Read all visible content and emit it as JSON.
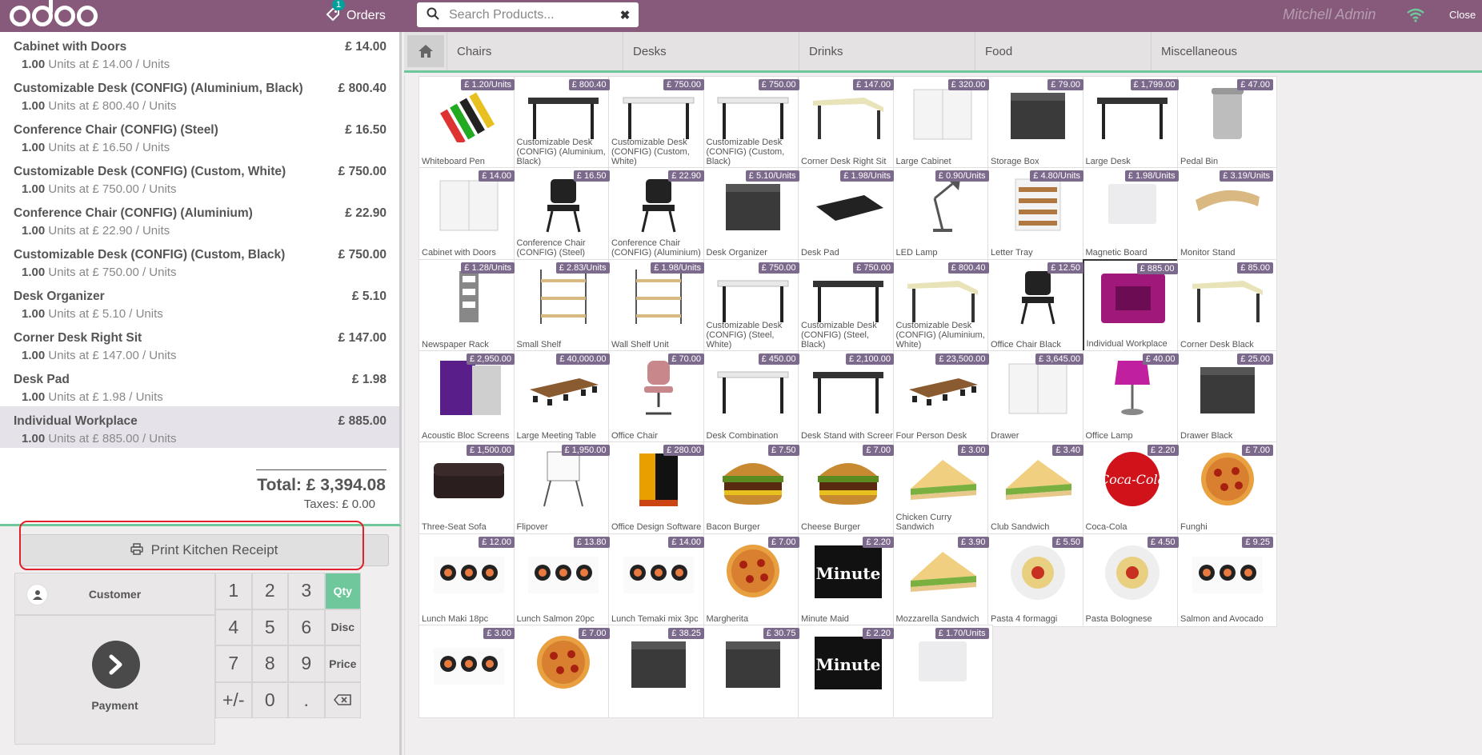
{
  "topbar": {
    "orders_label": "Orders",
    "orders_count": "1",
    "search_placeholder": "Search Products...",
    "user_name": "Mitchell Admin",
    "close_label": "Close"
  },
  "order": {
    "lines": [
      {
        "name": "Cabinet with Doors",
        "qty": "1.00",
        "info": "Units at £ 14.00 / Units",
        "price": "£ 14.00"
      },
      {
        "name": "Customizable Desk (CONFIG) (Aluminium, Black)",
        "qty": "1.00",
        "info": "Units at £ 800.40 / Units",
        "price": "£ 800.40"
      },
      {
        "name": "Conference Chair (CONFIG) (Steel)",
        "qty": "1.00",
        "info": "Units at £ 16.50 / Units",
        "price": "£ 16.50"
      },
      {
        "name": "Customizable Desk (CONFIG) (Custom, White)",
        "qty": "1.00",
        "info": "Units at £ 750.00 / Units",
        "price": "£ 750.00"
      },
      {
        "name": "Conference Chair (CONFIG) (Aluminium)",
        "qty": "1.00",
        "info": "Units at £ 22.90 / Units",
        "price": "£ 22.90"
      },
      {
        "name": "Customizable Desk (CONFIG) (Custom, Black)",
        "qty": "1.00",
        "info": "Units at £ 750.00 / Units",
        "price": "£ 750.00"
      },
      {
        "name": "Desk Organizer",
        "qty": "1.00",
        "info": "Units at £ 5.10 / Units",
        "price": "£ 5.10"
      },
      {
        "name": "Corner Desk Right Sit",
        "qty": "1.00",
        "info": "Units at £ 147.00 / Units",
        "price": "£ 147.00"
      },
      {
        "name": "Desk Pad",
        "qty": "1.00",
        "info": "Units at £ 1.98 / Units",
        "price": "£ 1.98"
      },
      {
        "name": "Individual Workplace",
        "qty": "1.00",
        "info": "Units at £ 885.00 / Units",
        "price": "£ 885.00"
      }
    ],
    "total": "Total: £ 3,394.08",
    "taxes": "Taxes: £ 0.00"
  },
  "controls": {
    "kitchen_label": "Print Kitchen Receipt",
    "customer_label": "Customer",
    "payment_label": "Payment",
    "keys": [
      "1",
      "2",
      "3",
      "4",
      "5",
      "6",
      "7",
      "8",
      "9",
      "+/-",
      "0",
      "."
    ],
    "modes": [
      "Qty",
      "Disc",
      "Price"
    ]
  },
  "categories": [
    "Chairs",
    "Desks",
    "Drinks",
    "Food",
    "Miscellaneous"
  ],
  "colors": {
    "brand": "#875a7b",
    "accent": "#6ec89b",
    "badge": "#7c6a8c",
    "highlight": "#e0202a"
  },
  "products": [
    {
      "name": "Whiteboard Pen",
      "price": "£ 1.20/Units",
      "icon": "pens"
    },
    {
      "name": "Customizable Desk (CONFIG) (Aluminium, Black)",
      "price": "£ 800.40",
      "icon": "desk-dark"
    },
    {
      "name": "Customizable Desk (CONFIG) (Custom, White)",
      "price": "£ 750.00",
      "icon": "desk-white"
    },
    {
      "name": "Customizable Desk (CONFIG) (Custom, Black)",
      "price": "£ 750.00",
      "icon": "desk-white"
    },
    {
      "name": "Corner Desk Right Sit",
      "price": "£ 147.00",
      "icon": "desk-cream"
    },
    {
      "name": "Large Cabinet",
      "price": "£ 320.00",
      "icon": "cabinet-white"
    },
    {
      "name": "Storage Box",
      "price": "£ 79.00",
      "icon": "box-dark"
    },
    {
      "name": "Large Desk",
      "price": "£ 1,799.00",
      "icon": "desk-dark"
    },
    {
      "name": "Pedal Bin",
      "price": "£ 47.00",
      "icon": "bin"
    },
    {
      "name": "Cabinet with Doors",
      "price": "£ 14.00",
      "icon": "cabinet-white"
    },
    {
      "name": "Conference Chair (CONFIG) (Steel)",
      "price": "£ 16.50",
      "icon": "chair-dark"
    },
    {
      "name": "Conference Chair (CONFIG) (Aluminium)",
      "price": "£ 22.90",
      "icon": "chair-dark"
    },
    {
      "name": "Desk Organizer",
      "price": "£ 5.10/Units",
      "icon": "box-dark"
    },
    {
      "name": "Desk Pad",
      "price": "£ 1.98/Units",
      "icon": "pad"
    },
    {
      "name": "LED Lamp",
      "price": "£ 0.90/Units",
      "icon": "lamp"
    },
    {
      "name": "Letter Tray",
      "price": "£ 4.80/Units",
      "icon": "tray"
    },
    {
      "name": "Magnetic Board",
      "price": "£ 1.98/Units",
      "icon": "board"
    },
    {
      "name": "Monitor Stand",
      "price": "£ 3.19/Units",
      "icon": "stand"
    },
    {
      "name": "Newspaper Rack",
      "price": "£ 1.28/Units",
      "icon": "rack"
    },
    {
      "name": "Small Shelf",
      "price": "£ 2.83/Units",
      "icon": "shelf"
    },
    {
      "name": "Wall Shelf Unit",
      "price": "£ 1.98/Units",
      "icon": "shelf"
    },
    {
      "name": "Customizable Desk (CONFIG) (Steel, White)",
      "price": "£ 750.00",
      "icon": "desk-white"
    },
    {
      "name": "Customizable Desk (CONFIG) (Steel, Black)",
      "price": "£ 750.00",
      "icon": "desk-dark"
    },
    {
      "name": "Customizable Desk (CONFIG) (Aluminium, White)",
      "price": "£ 800.40",
      "icon": "desk-cream"
    },
    {
      "name": "Office Chair Black",
      "price": "£ 12.50",
      "icon": "chair-dark"
    },
    {
      "name": "Individual Workplace",
      "price": "£ 885.00",
      "icon": "pod",
      "selected": true
    },
    {
      "name": "Corner Desk Black",
      "price": "£ 85.00",
      "icon": "desk-cream"
    },
    {
      "name": "Acoustic Bloc Screens",
      "price": "£ 2,950.00",
      "icon": "screen"
    },
    {
      "name": "Large Meeting Table",
      "price": "£ 40,000.00",
      "icon": "table"
    },
    {
      "name": "Office Chair",
      "price": "£ 70.00",
      "icon": "chair-pink"
    },
    {
      "name": "Desk Combination",
      "price": "£ 450.00",
      "icon": "desk-white"
    },
    {
      "name": "Desk Stand with Screen",
      "price": "£ 2,100.00",
      "icon": "desk-dark"
    },
    {
      "name": "Four Person Desk",
      "price": "£ 23,500.00",
      "icon": "table"
    },
    {
      "name": "Drawer",
      "price": "£ 3,645.00",
      "icon": "cabinet-white"
    },
    {
      "name": "Office Lamp",
      "price": "£ 40.00",
      "icon": "lamp-pink"
    },
    {
      "name": "Drawer Black",
      "price": "£ 25.00",
      "icon": "box-dark"
    },
    {
      "name": "Three-Seat Sofa",
      "price": "£ 1,500.00",
      "icon": "sofa"
    },
    {
      "name": "Flipover",
      "price": "£ 1,950.00",
      "icon": "flip"
    },
    {
      "name": "Office Design Software",
      "price": "£ 280.00",
      "icon": "software"
    },
    {
      "name": "Bacon Burger",
      "price": "£ 7.50",
      "icon": "burger"
    },
    {
      "name": "Cheese Burger",
      "price": "£ 7.00",
      "icon": "burger"
    },
    {
      "name": "Chicken Curry Sandwich",
      "price": "£ 3.00",
      "icon": "sandwich"
    },
    {
      "name": "Club Sandwich",
      "price": "£ 3.40",
      "icon": "sandwich"
    },
    {
      "name": "Coca-Cola",
      "price": "£ 2.20",
      "icon": "cola"
    },
    {
      "name": "Funghi",
      "price": "£ 7.00",
      "icon": "pizza"
    },
    {
      "name": "Lunch Maki 18pc",
      "price": "£ 12.00",
      "icon": "sushi"
    },
    {
      "name": "Lunch Salmon 20pc",
      "price": "£ 13.80",
      "icon": "sushi"
    },
    {
      "name": "Lunch Temaki mix 3pc",
      "price": "£ 14.00",
      "icon": "sushi"
    },
    {
      "name": "Margherita",
      "price": "£ 7.00",
      "icon": "pizza"
    },
    {
      "name": "Minute Maid",
      "price": "£ 2.20",
      "icon": "juice"
    },
    {
      "name": "Mozzarella Sandwich",
      "price": "£ 3.90",
      "icon": "sandwich"
    },
    {
      "name": "Pasta 4 formaggi",
      "price": "£ 5.50",
      "icon": "pasta"
    },
    {
      "name": "Pasta Bolognese",
      "price": "£ 4.50",
      "icon": "pasta"
    },
    {
      "name": "Salmon and Avocado",
      "price": "£ 9.25",
      "icon": "sushi"
    },
    {
      "name": "",
      "price": "£ 3.00",
      "icon": "sushi"
    },
    {
      "name": "",
      "price": "£ 7.00",
      "icon": "pizza"
    },
    {
      "name": "",
      "price": "£ 38.25",
      "icon": "box-dark"
    },
    {
      "name": "",
      "price": "£ 30.75",
      "icon": "box-dark"
    },
    {
      "name": "",
      "price": "£ 2.20",
      "icon": "juice"
    },
    {
      "name": "",
      "price": "£ 1.70/Units",
      "icon": "board"
    }
  ]
}
